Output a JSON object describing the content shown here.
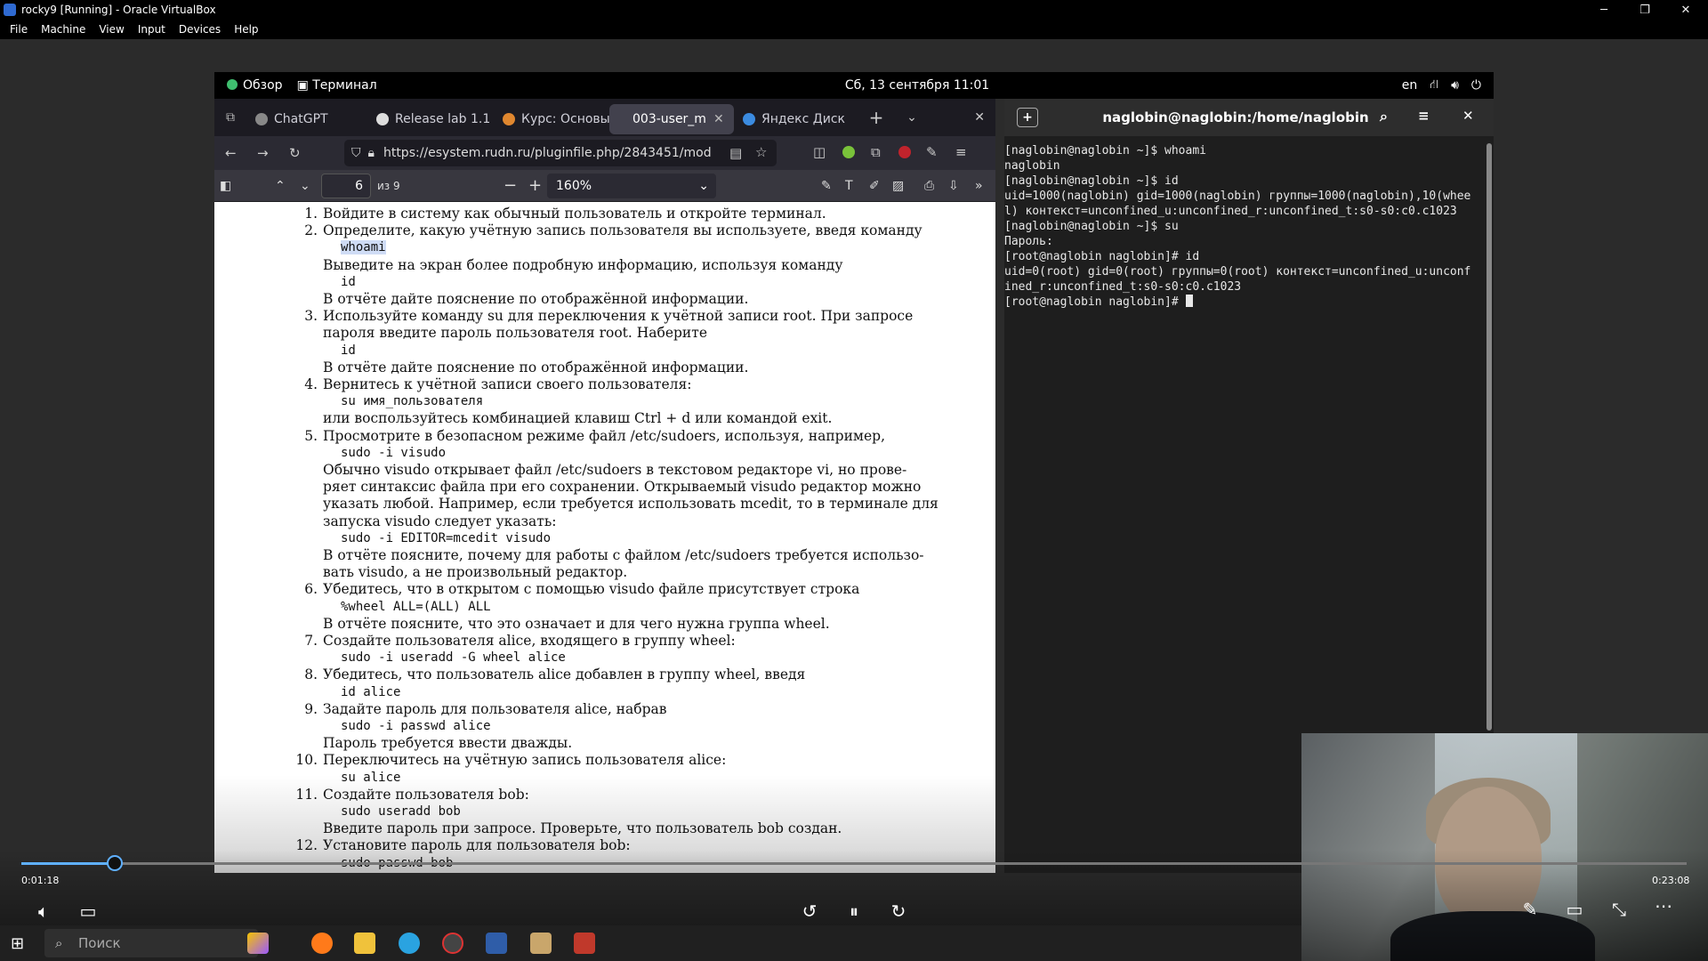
{
  "vbox": {
    "title": "rocky9 [Running] - Oracle VirtualBox",
    "menu": [
      "File",
      "Machine",
      "View",
      "Input",
      "Devices",
      "Help"
    ]
  },
  "gnome": {
    "overview": "Обзор",
    "terminal_app": "Терминал",
    "clock": "Сб, 13 сентября  11:01",
    "lang": "en"
  },
  "firefox": {
    "tabs": [
      {
        "label": "ChatGPT"
      },
      {
        "label": "Release lab 1.1"
      },
      {
        "label": "Курс: Основы"
      },
      {
        "label": "003-user_m"
      },
      {
        "label": "Яндекс Диск"
      }
    ],
    "url": "https://esystem.rudn.ru/pluginfile.php/2843451/mod",
    "pdf": {
      "page": "6",
      "page_total": "из 9",
      "zoom": "160%"
    }
  },
  "doc": {
    "lines": [
      "1.|Войдите в систему как обычный пользователь и откройте терминал.",
      "2.|Определите, какую учётную запись пользователя вы используете, введя команду",
      "code|whoami",
      "txt|Выведите на экран более подробную информацию, используя команду",
      "code|id",
      "txt|В отчёте дайте пояснение по отображённой информации.",
      "3.|Используйте команду su для переключения к учётной записи root. При запросе",
      "txt|пароля введите пароль пользователя root. Наберите",
      "code|id",
      "txt|В отчёте дайте пояснение по отображённой информации.",
      "4.|Вернитесь к учётной записи своего пользователя:",
      "code|su имя_пользователя",
      "txt|или воспользуйтесь комбинацией клавиш Ctrl + d или командой exit.",
      "5.|Просмотрите в безопасном режиме файл /etc/sudoers, используя, например,",
      "code|sudo -i visudo",
      "txt|Обычно visudo открывает файл /etc/sudoers в текстовом редакторе vi, но прове-",
      "txt|ряет синтаксис файла при его сохранении. Открываемый visudo редактор можно",
      "txt|указать любой. Например, если требуется использовать mcedit, то в терминале для",
      "txt|запуска visudo следует указать:",
      "code|sudo -i EDITOR=mcedit visudo",
      "txt|В отчёте поясните, почему для работы с файлом /etc/sudoers требуется использо-",
      "txt|вать visudo, а не произвольный редактор.",
      "6.|Убедитесь, что в открытом с помощью visudo файле присутствует строка",
      "code|%wheel ALL=(ALL) ALL",
      "txt|В отчёте поясните, что это означает и для чего нужна группа wheel.",
      "7.|Создайте пользователя alice, входящего в группу wheel:",
      "code|sudo -i useradd -G wheel alice",
      "8.|Убедитесь, что пользователь alice добавлен в группу wheel, введя",
      "code|id alice",
      "9.|Задайте пароль для пользователя alice, набрав",
      "code|sudo -i passwd alice",
      "txt|Пароль требуется ввести дважды.",
      "10.|Переключитесь на учётную запись пользователя alice:",
      "code|su alice",
      "11.|Создайте пользователя bob:",
      "code|sudo useradd bob",
      "txt|Введите пароль при запросе. Проверьте, что пользователь bob создан.",
      "12.|Установите пароль для пользователя bob:",
      "code|sudo passwd bob"
    ]
  },
  "terminal": {
    "title": "naglobin@naglobin:/home/naglobin",
    "lines": [
      "[naglobin@naglobin ~]$ whoami",
      "naglobin",
      "[naglobin@naglobin ~]$ id",
      "uid=1000(naglobin) gid=1000(naglobin) группы=1000(naglobin),10(whee",
      "l) контекст=unconfined_u:unconfined_r:unconfined_t:s0-s0:c0.c1023",
      "[naglobin@naglobin ~]$ su",
      "Пароль:",
      "[root@naglobin naglobin]# id",
      "uid=0(root) gid=0(root) группы=0(root) контекст=unconfined_u:unconf",
      "ined_r:unconfined_t:s0-s0:c0.c1023",
      "[root@naglobin naglobin]# "
    ]
  },
  "player": {
    "elapsed": "0:01:18",
    "total": "0:23:08",
    "progress": 0.056
  },
  "taskbar": {
    "search_placeholder": "Поиск"
  }
}
